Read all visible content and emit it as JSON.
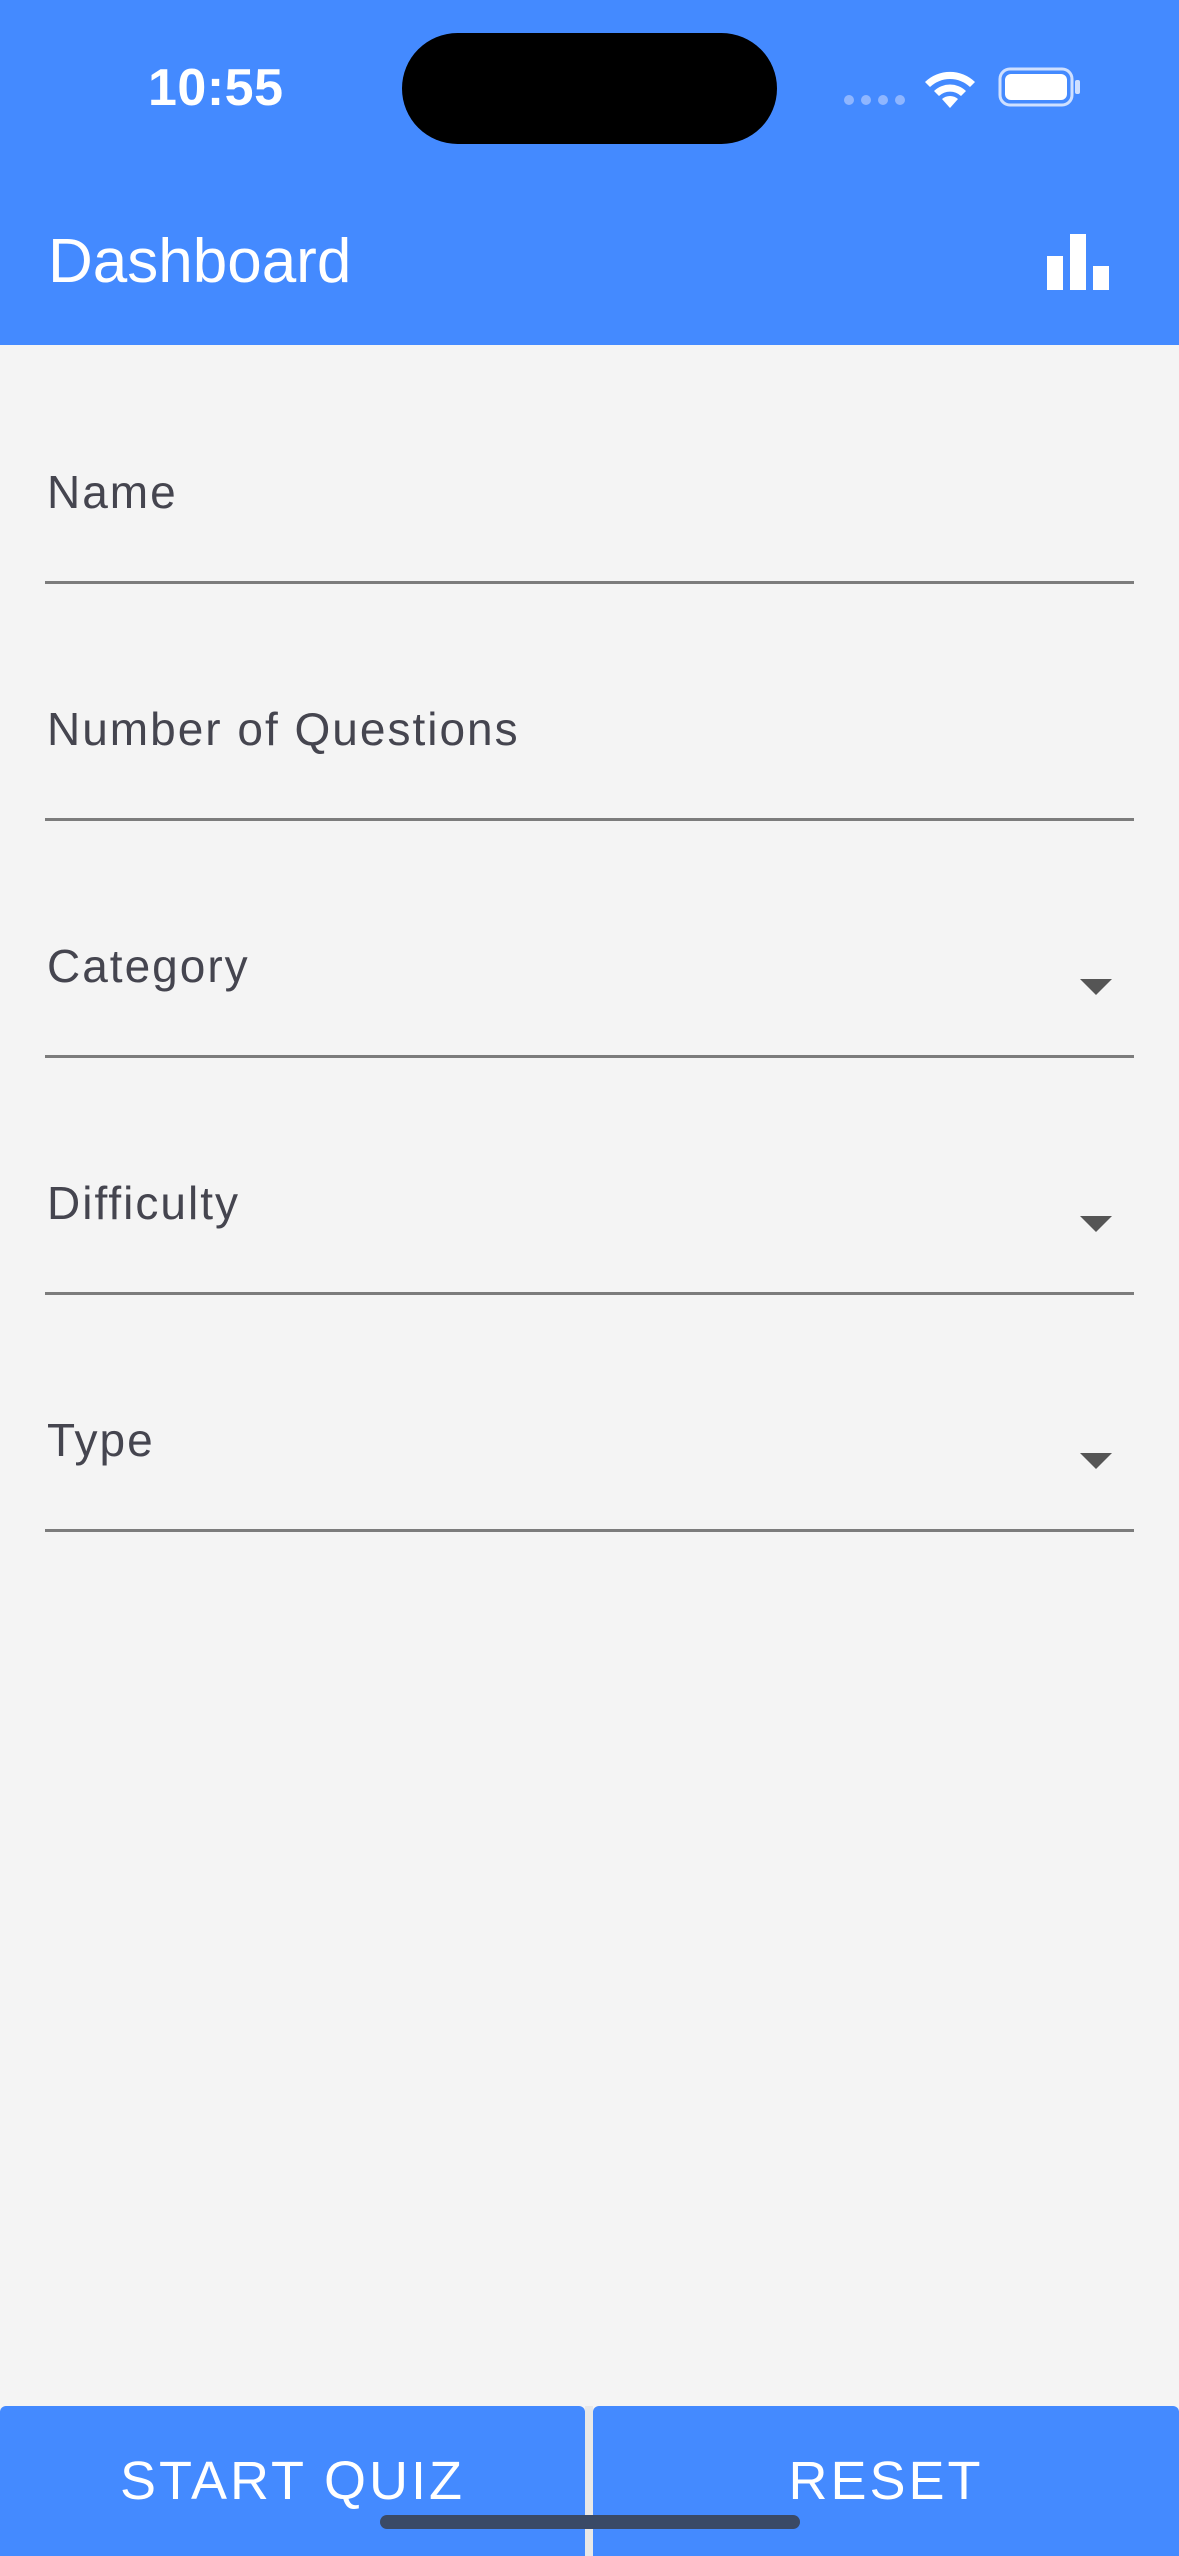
{
  "status_bar": {
    "time": "10:55"
  },
  "app_bar": {
    "title": "Dashboard",
    "action_icon": "bar-chart-icon"
  },
  "form": {
    "fields": [
      {
        "label": "Name",
        "type": "text",
        "value": ""
      },
      {
        "label": "Number of Questions",
        "type": "number",
        "value": ""
      },
      {
        "label": "Category",
        "type": "dropdown",
        "value": ""
      },
      {
        "label": "Difficulty",
        "type": "dropdown",
        "value": ""
      },
      {
        "label": "Type",
        "type": "dropdown",
        "value": ""
      }
    ]
  },
  "buttons": {
    "start_label": "START QUIZ",
    "reset_label": "RESET"
  },
  "colors": {
    "primary": "#448aff",
    "background": "#f4f4f4",
    "label": "#45454f",
    "underline": "#7c7c7c"
  }
}
